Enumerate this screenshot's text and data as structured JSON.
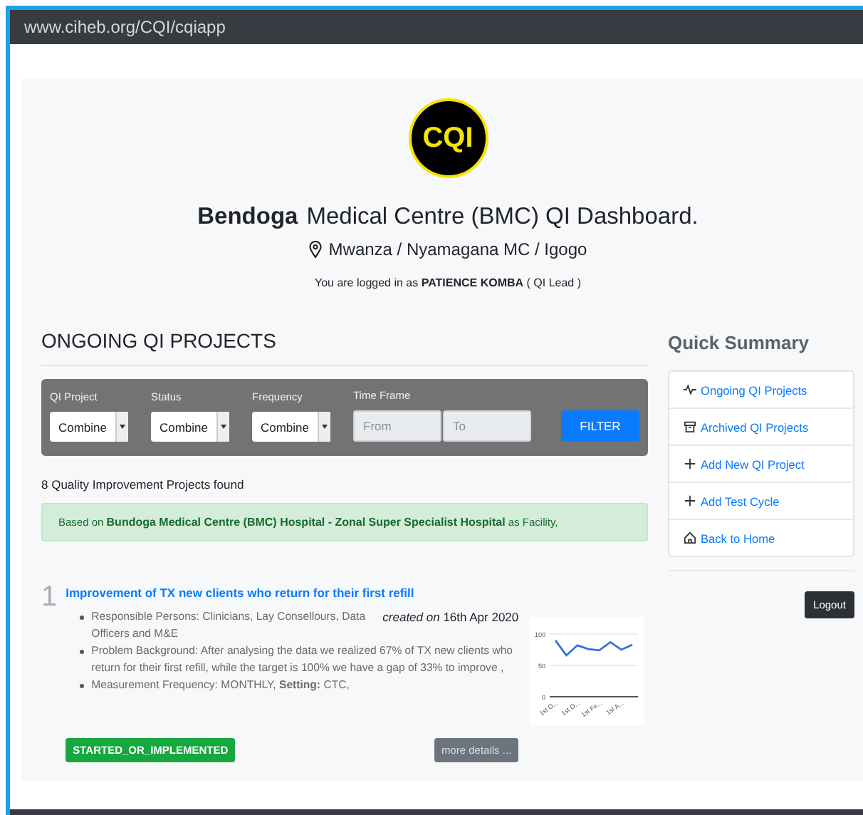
{
  "browser": {
    "url": "www.ciheb.org/CQI/cqiapp"
  },
  "header": {
    "logo_text": "CQI",
    "facility": "Bendoga",
    "title": "Medical Centre (BMC) QI Dashboard.",
    "location": "Mwanza / Nyamagana MC / Igogo",
    "login": "You are logged in as **PATIENCE KOMBA** ( QI Lead )"
  },
  "section_title": "ONGOING QI PROJECTS",
  "filters": [
    {
      "kind": "select",
      "label": "QI Project",
      "value": "Combine"
    },
    {
      "kind": "select",
      "label": "Status",
      "value": "Combine"
    },
    {
      "kind": "select",
      "label": "Frequency",
      "value": "Combine"
    },
    {
      "kind": "range",
      "label": "Time Frame",
      "from_placeholder": "From",
      "to_placeholder": "To"
    }
  ],
  "filter_button": "FILTER",
  "found": "8 Quality Improvement Projects found",
  "info": "Based on **Bundoga  Medical Centre (BMC) Hospital - Zonal Super Specialist Hospital** as Facility,",
  "projects": [
    {
      "number": "1",
      "title": "Improvement of TX new clients who return for their first refill",
      "created": "*created on* 16th Apr 2020",
      "details": [
        "Responsible Persons: Clinicians, Lay Consellours, Data Officers and M&E",
        "Problem Background: After analysing the data we realized 67% of TX new clients who return for their first refill, while the target is 100% we have a gap of 33% to improve ,",
        "Measurement Frequency: MONTHLY, **Setting:** CTC,"
      ],
      "status": "STARTED_OR_IMPLEMENTED",
      "more_button": "more details ...",
      "chart_x_labels": [
        "1st O...",
        "1st O...",
        "1st Fe...",
        "1st A..."
      ],
      "chart_data": {
        "type": "line",
        "series": [
          {
            "color": "#3b6fd6",
            "values": [
              90,
              66,
              82,
              76,
              74,
              87,
              75,
              83
            ]
          }
        ],
        "ylim": [
          0,
          100
        ],
        "yticks": [
          0,
          50,
          100
        ]
      }
    }
  ],
  "summary": {
    "title": "Quick Summary",
    "items": [
      {
        "kind": "activity",
        "label": "Ongoing QI Projects"
      },
      {
        "kind": "archive",
        "label": "Archived QI Projects"
      },
      {
        "kind": "plus",
        "label": "Add New QI Project"
      },
      {
        "kind": "plus",
        "label": "Add Test Cycle"
      },
      {
        "kind": "home",
        "label": "Back to Home"
      }
    ],
    "logout": "Logout"
  }
}
